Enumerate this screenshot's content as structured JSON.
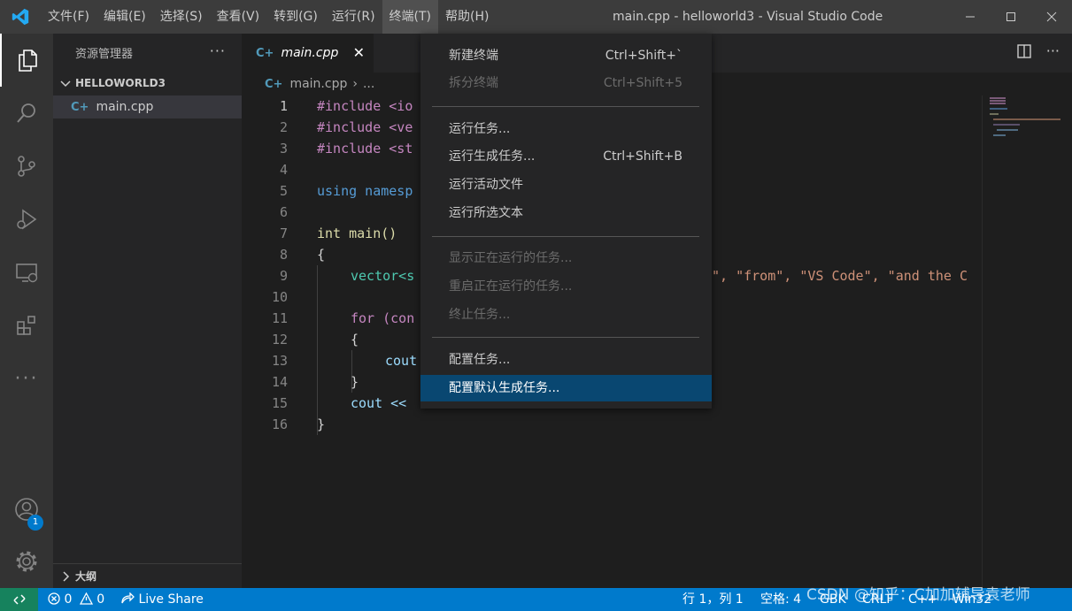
{
  "window": {
    "title": "main.cpp - helloworld3 - Visual Studio Code",
    "menus": [
      "文件(F)",
      "编辑(E)",
      "选择(S)",
      "查看(V)",
      "转到(G)",
      "运行(R)",
      "终端(T)",
      "帮助(H)"
    ],
    "active_menu": "终端(T)"
  },
  "activity_bar": {
    "items": [
      "files-icon",
      "search-icon",
      "source-control-icon",
      "run-debug-icon",
      "remote-explorer-icon",
      "extensions-icon",
      "more-icon"
    ],
    "bottom": [
      "account-icon",
      "settings-gear-icon"
    ],
    "account_badge": "1"
  },
  "sidebar": {
    "title": "资源管理器",
    "more": "···",
    "folder": "HELLOWORLD3",
    "file": "main.cpp",
    "outline": "大纲"
  },
  "editor": {
    "tab_label": "main.cpp",
    "tab_close": "✕",
    "breadcrumb_file": "main.cpp",
    "breadcrumb_sep": "›",
    "breadcrumb_more": "...",
    "lines": [
      {
        "n": "1",
        "code": "#include <io"
      },
      {
        "n": "2",
        "code": "#include <ve"
      },
      {
        "n": "3",
        "code": "#include <st"
      },
      {
        "n": "4",
        "code": ""
      },
      {
        "n": "5",
        "code": "using namesp"
      },
      {
        "n": "6",
        "code": ""
      },
      {
        "n": "7",
        "code": "int main()"
      },
      {
        "n": "8",
        "code": "{"
      },
      {
        "n": "9",
        "code": "vector<s",
        "tail": "\", \"from\", \"VS Code\", \"and the C"
      },
      {
        "n": "10",
        "code": ""
      },
      {
        "n": "11",
        "code": "for (con"
      },
      {
        "n": "12",
        "code": "{"
      },
      {
        "n": "13",
        "code": "cout"
      },
      {
        "n": "14",
        "code": "}"
      },
      {
        "n": "15",
        "code": "cout <<"
      },
      {
        "n": "16",
        "code": "}"
      }
    ]
  },
  "terminal_menu": {
    "items": [
      {
        "label": "新建终端",
        "key": "Ctrl+Shift+`",
        "enabled": true
      },
      {
        "label": "拆分终端",
        "key": "Ctrl+Shift+5",
        "enabled": false
      },
      {
        "label": "运行任务...",
        "key": "",
        "enabled": true
      },
      {
        "label": "运行生成任务...",
        "key": "Ctrl+Shift+B",
        "enabled": true
      },
      {
        "label": "运行活动文件",
        "key": "",
        "enabled": true
      },
      {
        "label": "运行所选文本",
        "key": "",
        "enabled": true
      },
      {
        "label": "显示正在运行的任务...",
        "key": "",
        "enabled": false
      },
      {
        "label": "重启正在运行的任务...",
        "key": "",
        "enabled": false
      },
      {
        "label": "终止任务...",
        "key": "",
        "enabled": false
      },
      {
        "label": "配置任务...",
        "key": "",
        "enabled": true
      },
      {
        "label": "配置默认生成任务...",
        "key": "",
        "enabled": true,
        "selected": true
      }
    ]
  },
  "status_bar": {
    "errors": "0",
    "warnings": "0",
    "live_share": "Live Share",
    "position": "行 1，列 1",
    "spaces": "空格: 4",
    "encoding": "GBK",
    "eol": "CRLF",
    "language": "C++",
    "platform": "Win32"
  },
  "watermark": "CSDN @知乎：C加加辅导袁老师",
  "colors": {
    "accent": "#007acc",
    "selected_menu": "#094771",
    "remote": "#16825d"
  }
}
